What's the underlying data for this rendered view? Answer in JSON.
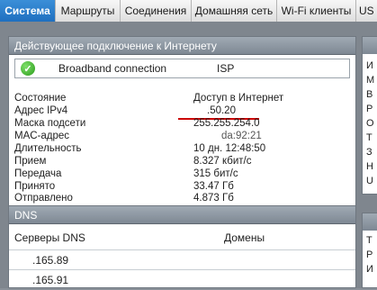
{
  "tabs": [
    {
      "label": "Система",
      "active": true
    },
    {
      "label": "Маршруты",
      "active": false
    },
    {
      "label": "Соединения",
      "active": false
    },
    {
      "label": "Домашняя сеть",
      "active": false
    },
    {
      "label": "Wi-Fi клиенты",
      "active": false
    },
    {
      "label": "US",
      "active": false
    }
  ],
  "internet_panel": {
    "title": "Действующее подключение к Интернету",
    "connection": {
      "name": "Broadband connection",
      "type": "ISP",
      "status_icon": "check-circle-icon"
    },
    "rows": [
      {
        "label": "Состояние",
        "value": "Доступ в Интернет"
      },
      {
        "label": "Адрес IPv4",
        "value": ".50.20"
      },
      {
        "label": "Маска подсети",
        "value": "255.255.254.0"
      },
      {
        "label": "MAC-адрес",
        "value": "da:92:21"
      },
      {
        "label": "Длительность",
        "value": "10 дн. 12:48:50"
      },
      {
        "label": "Прием",
        "value": "8.327 кбит/с"
      },
      {
        "label": "Передача",
        "value": "315 бит/с"
      },
      {
        "label": "Принято",
        "value": "33.47 Гб"
      },
      {
        "label": "Отправлено",
        "value": "4.873 Гб"
      }
    ]
  },
  "dns_panel": {
    "title": "DNS",
    "col_servers": "Серверы DNS",
    "col_domains": "Домены",
    "rows": [
      {
        "server": ".165.89"
      },
      {
        "server": ".165.91"
      }
    ]
  },
  "side_panel_letters_top": [
    "И",
    "М",
    "В",
    "Р",
    "О",
    "Т",
    "З",
    "Н",
    "U"
  ],
  "side_panel_letters_bottom": [
    "Т",
    "Р",
    "И"
  ],
  "colors": {
    "accent_tab": "#2a7fcf",
    "underline": "#cc0000",
    "check": "#2a9a1a"
  }
}
